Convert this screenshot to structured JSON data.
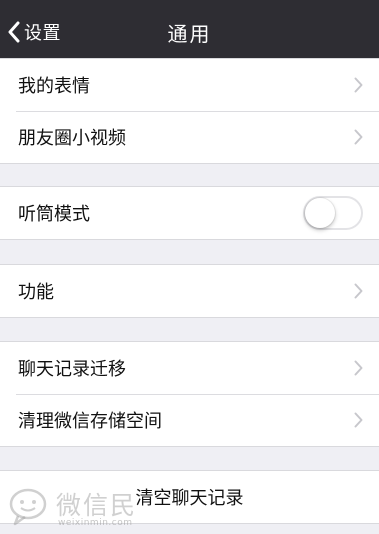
{
  "nav": {
    "back_label": "设置",
    "title": "通用"
  },
  "group1": {
    "items": [
      {
        "label": "我的表情"
      },
      {
        "label": "朋友圈小视频"
      }
    ]
  },
  "group2": {
    "items": [
      {
        "label": "听筒模式",
        "toggle_on": false
      }
    ]
  },
  "group3": {
    "items": [
      {
        "label": "功能"
      }
    ]
  },
  "group4": {
    "items": [
      {
        "label": "聊天记录迁移"
      },
      {
        "label": "清理微信存储空间"
      }
    ]
  },
  "group5": {
    "action_label": "清空聊天记录"
  },
  "watermark": {
    "text": "微信民",
    "url": "weixinmin.com"
  },
  "colors": {
    "navbar_bg": "#2e2d33",
    "page_bg": "#efeff4",
    "cell_bg": "#ffffff",
    "chevron": "#c7c7cc"
  }
}
